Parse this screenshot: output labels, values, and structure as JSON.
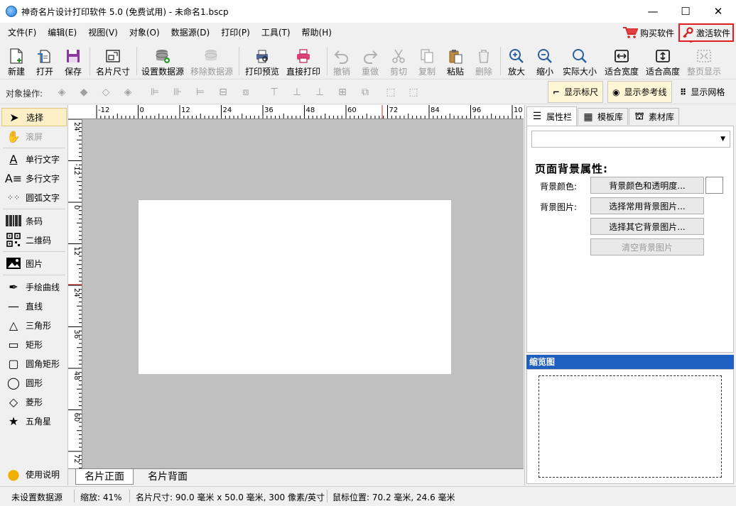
{
  "window": {
    "title": "神奇名片设计打印软件 5.0 (免费试用) - 未命名1.bscp",
    "minimize": "—",
    "maximize": "☐",
    "close": "✕"
  },
  "menu": [
    "文件(F)",
    "编辑(E)",
    "视图(V)",
    "对象(O)",
    "数据源(D)",
    "打印(P)",
    "工具(T)",
    "帮助(H)"
  ],
  "header_actions": {
    "buy": "购买软件",
    "activate": "激活软件"
  },
  "toolbar": {
    "new": "新建",
    "open": "打开",
    "save": "保存",
    "card_size": "名片尺寸",
    "set_datasource": "设置数据源",
    "remove_datasource": "移除数据源",
    "print_preview": "打印预览",
    "direct_print": "直接打印",
    "undo": "撤销",
    "redo": "重做",
    "cut": "剪切",
    "copy": "复制",
    "paste": "粘贴",
    "delete": "删除",
    "zoom_in": "放大",
    "zoom_out": "缩小",
    "actual_size": "实际大小",
    "fit_width": "适合宽度",
    "fit_height": "适合高度",
    "fit_page": "整页显示"
  },
  "objbar": {
    "label": "对象操作:",
    "show_ruler": "显示标尺",
    "show_guides": "显示参考线",
    "show_grid": "显示网格"
  },
  "tools": {
    "select": "选择",
    "scroll": "滚屏",
    "single_text": "单行文字",
    "multi_text": "多行文字",
    "arc_text": "圆弧文字",
    "barcode": "条码",
    "qrcode": "二维码",
    "image": "图片",
    "freehand": "手绘曲线",
    "line": "直线",
    "triangle": "三角形",
    "rectangle": "矩形",
    "rounded_rect": "圆角矩形",
    "ellipse": "圆形",
    "diamond": "菱形",
    "star": "五角星",
    "help": "使用说明"
  },
  "ruler": {
    "h_labels": [
      "-12",
      "0",
      "12",
      "24",
      "36",
      "48",
      "60",
      "72",
      "84",
      "96",
      "10"
    ],
    "v_labels": [
      "24",
      "-12",
      "0",
      "12",
      "24",
      "36",
      "48",
      "60",
      "72"
    ]
  },
  "card_tabs": {
    "front": "名片正面",
    "back": "名片背面"
  },
  "right_tabs": {
    "properties": "属性栏",
    "templates": "模板库",
    "materials": "素材库"
  },
  "properties": {
    "section_title": "页面背景属性:",
    "bg_color_label": "背景颜色:",
    "bg_color_button": "背景颜色和透明度...",
    "bg_image_label": "背景图片:",
    "select_common_bg": "选择常用背景图片...",
    "select_other_bg": "选择其它背景图片...",
    "clear_bg": "清空背景图片",
    "swatch_color": "#ffffff"
  },
  "thumbnail": {
    "title": "缩览图"
  },
  "status": {
    "datasource": "未设置数据源",
    "zoom": "缩放: 41%",
    "card_size": "名片尺寸: 90.0 毫米 x 50.0 毫米, 300 像素/英寸",
    "mouse_pos": "鼠标位置: 70.2 毫米, 24.6 毫米"
  },
  "colors": {
    "accent": "#1f5fbf",
    "highlight_border": "#e02020",
    "canvas_bg": "#c0c0c0"
  }
}
